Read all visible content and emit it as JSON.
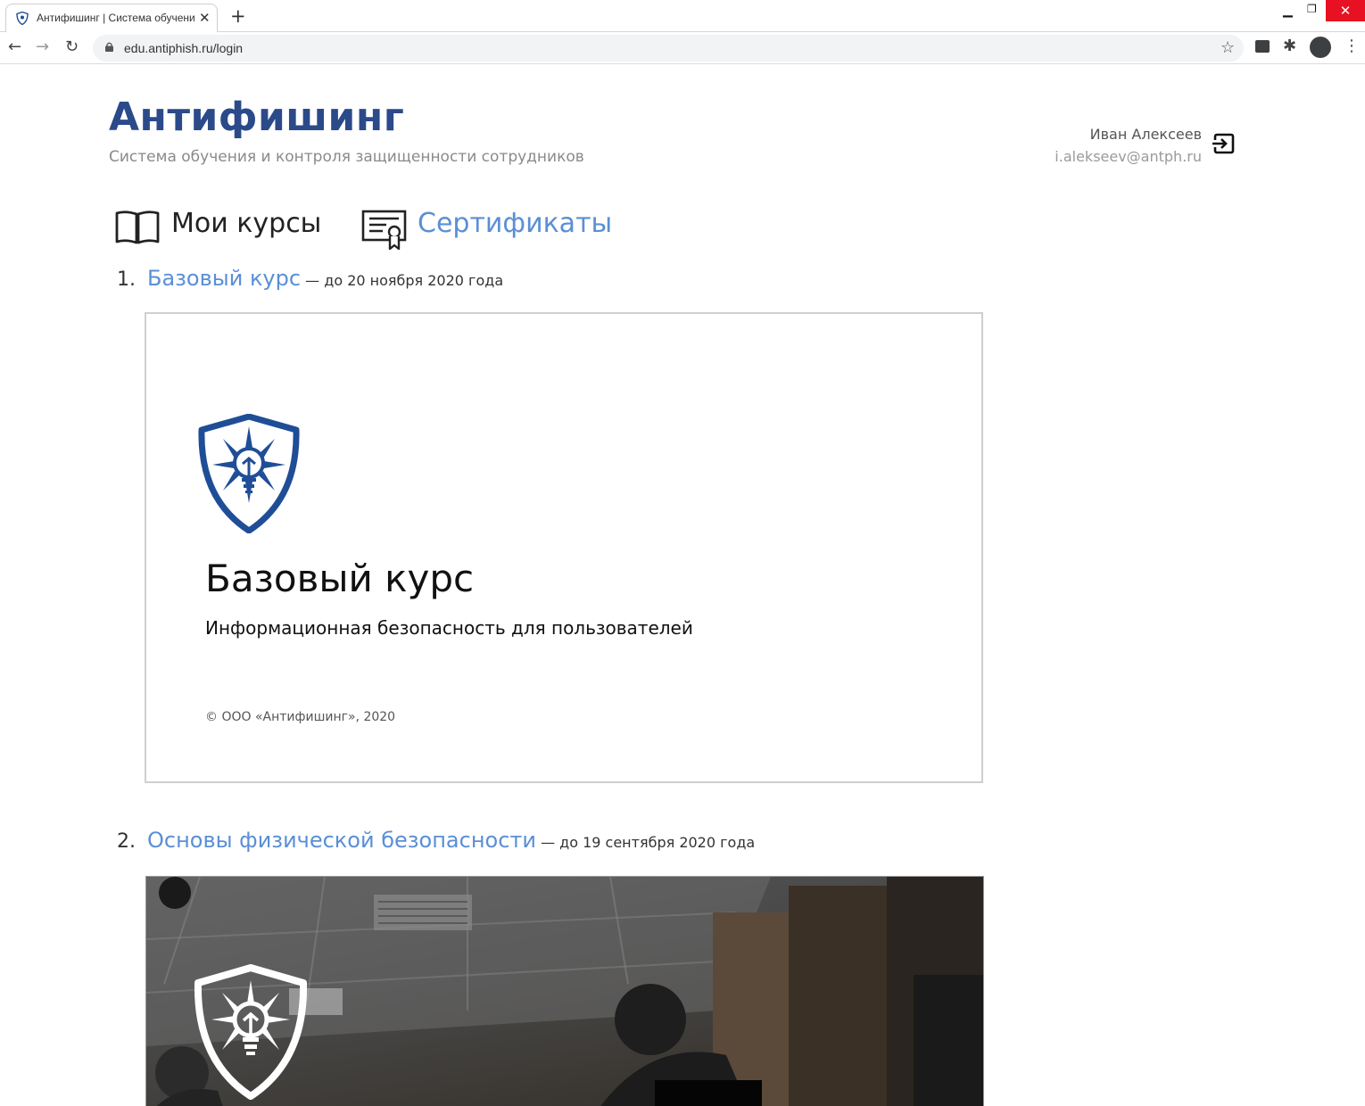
{
  "browser": {
    "tab_title": "Антифишинг | Система обучения",
    "url": "edu.antiphish.ru/login",
    "icons": [
      "shield-favicon-icon",
      "close-icon",
      "plus-icon",
      "back-arrow-icon",
      "forward-arrow-icon",
      "reload-icon",
      "lock-icon",
      "star-icon",
      "extension-icon",
      "puzzle-icon",
      "profile-icon",
      "kebab-menu-icon"
    ]
  },
  "header": {
    "title": "Антифишинг",
    "subtitle": "Система обучения и контроля защищенности сотрудников",
    "user_name": "Иван Алексеев",
    "user_email": "i.alekseev@antph.ru"
  },
  "nav": {
    "my_courses": "Мои курсы",
    "certificates": "Сертификаты"
  },
  "courses": [
    {
      "number": "1.",
      "title": "Базовый курс",
      "due": "— до 20 ноября 2020 года",
      "cover_title": "Базовый курс",
      "cover_subtitle": "Информационная безопасность для пользователей",
      "cover_copyright": "© ООО «Антифишинг», 2020"
    },
    {
      "number": "2.",
      "title": "Основы физической безопасности",
      "due": "— до 19 сентября 2020 года"
    }
  ],
  "colors": {
    "brand": "#2b4a8a",
    "link": "#5a8fd6",
    "logo_blue": "#1f4e97"
  }
}
